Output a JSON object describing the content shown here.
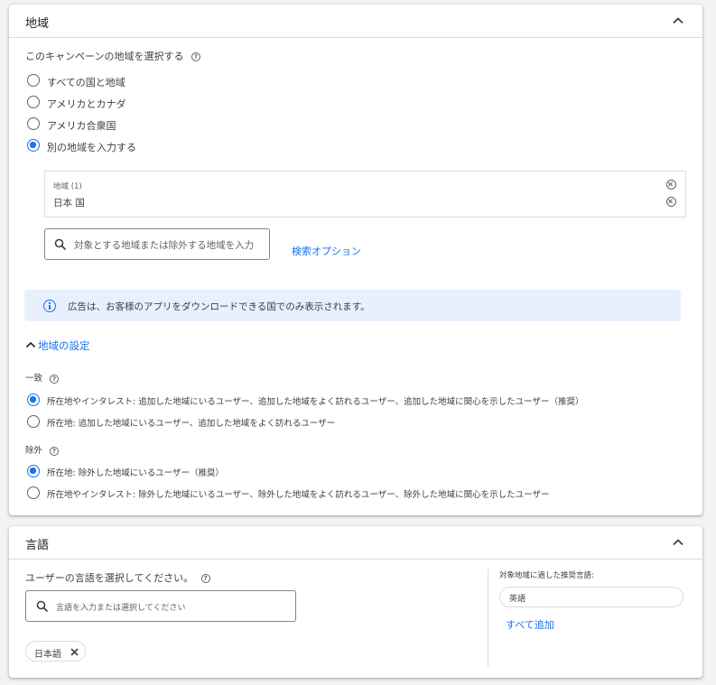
{
  "region_section": {
    "title": "地域",
    "select_label": "このキャンペーンの地域を選択する",
    "options": [
      {
        "label": "すべての国と地域",
        "selected": false
      },
      {
        "label": "アメリカとカナダ",
        "selected": false
      },
      {
        "label": "アメリカ合衆国",
        "selected": false
      },
      {
        "label": "別の地域を入力する",
        "selected": true
      }
    ],
    "selected_box": {
      "header": "地域 (1)",
      "item": "日本 国"
    },
    "search_placeholder": "対象とする地域または除外する地域を入力",
    "search_options_link": "検索オプション",
    "info_message": "広告は、お客様のアプリをダウンロードできる国でのみ表示されます。",
    "settings_toggle": "地域の設定",
    "include": {
      "label": "一致",
      "options": [
        {
          "label": "所在地やインタレスト: 追加した地域にいるユーザー、追加した地域をよく訪れるユーザー、追加した地域に関心を示したユーザー（推奨）",
          "selected": true
        },
        {
          "label": "所在地: 追加した地域にいるユーザー、追加した地域をよく訪れるユーザー",
          "selected": false
        }
      ]
    },
    "exclude": {
      "label": "除外",
      "options": [
        {
          "label": "所在地: 除外した地域にいるユーザー（推奨）",
          "selected": true
        },
        {
          "label": "所在地やインタレスト: 除外した地域にいるユーザー、除外した地域をよく訪れるユーザー、除外した地域に関心を示したユーザー",
          "selected": false
        }
      ]
    }
  },
  "language_section": {
    "title": "言語",
    "select_label": "ユーザーの言語を選択してください。",
    "search_placeholder": "言語を入力または選択してください",
    "chip_label": "日本語",
    "recommended_label": "対象地域に適した推奨言語:",
    "recommended_item": "英語",
    "add_all_link": "すべて追加"
  },
  "colors": {
    "accent": "#1a73e8",
    "info_bg": "#e8f0fe",
    "link": "#1a73e8"
  }
}
